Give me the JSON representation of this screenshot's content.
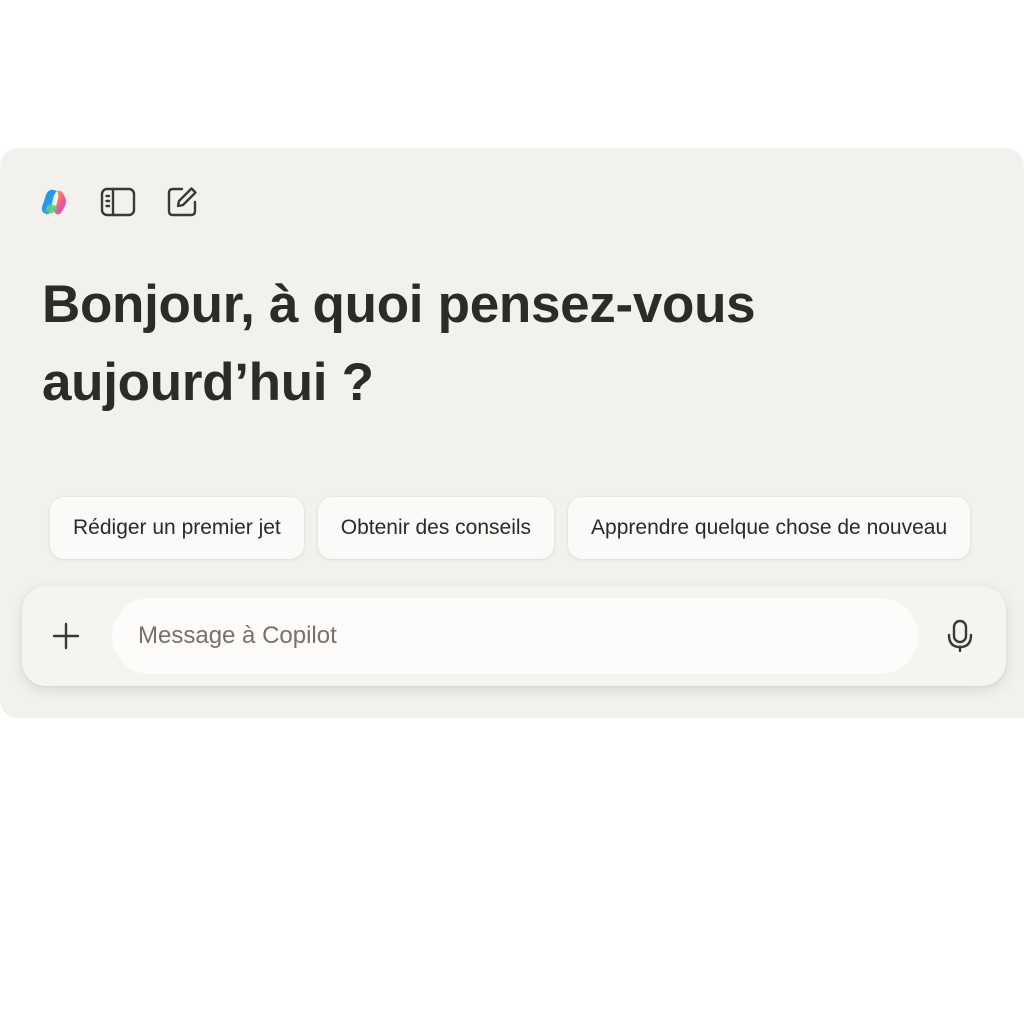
{
  "toolbar": {
    "icons": [
      "copilot-logo-icon",
      "sidebar-toggle-icon",
      "new-chat-icon"
    ]
  },
  "main": {
    "greeting": "Bonjour, à quoi pensez-vous aujourd’hui ?"
  },
  "suggestions": [
    {
      "label": "Rédiger un premier jet"
    },
    {
      "label": "Obtenir des conseils"
    },
    {
      "label": "Apprendre quelque chose de nouveau"
    }
  ],
  "composer": {
    "placeholder": "Message à Copilot",
    "value": "",
    "add_icon": "plus-icon",
    "mic_icon": "microphone-icon"
  },
  "colors": {
    "window_background": "#f3f1ee",
    "text_primary": "#2c2b29",
    "chip_background": "#fbfaf8"
  }
}
